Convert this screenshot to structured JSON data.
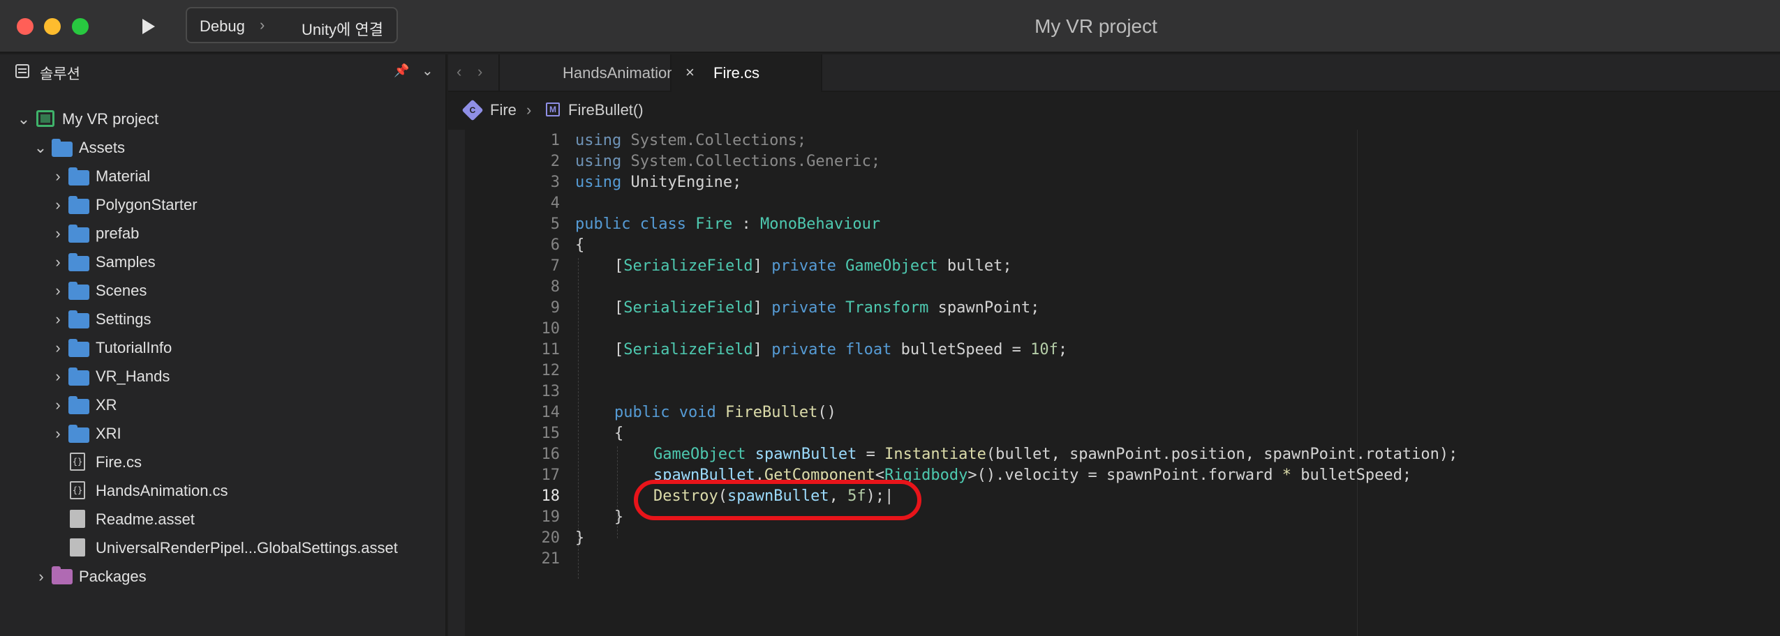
{
  "window": {
    "title": "My VR project",
    "run_config": "Debug",
    "run_target": "Unity에 연결",
    "icons": [
      "play-icon",
      "chevron-right-icon"
    ]
  },
  "sidebar": {
    "title": "솔루션",
    "tree": [
      {
        "label": "My VR project",
        "icon": "project-icon",
        "expanded": true
      },
      {
        "label": "Assets",
        "icon": "folder-icon",
        "expanded": true
      },
      {
        "label": "Material",
        "icon": "folder-icon"
      },
      {
        "label": "PolygonStarter",
        "icon": "folder-icon"
      },
      {
        "label": "prefab",
        "icon": "folder-icon"
      },
      {
        "label": "Samples",
        "icon": "folder-icon"
      },
      {
        "label": "Scenes",
        "icon": "folder-icon"
      },
      {
        "label": "Settings",
        "icon": "folder-icon"
      },
      {
        "label": "TutorialInfo",
        "icon": "folder-icon"
      },
      {
        "label": "VR_Hands",
        "icon": "folder-icon"
      },
      {
        "label": "XR",
        "icon": "folder-icon"
      },
      {
        "label": "XRI",
        "icon": "folder-icon"
      },
      {
        "label": "Fire.cs",
        "icon": "csharp-file-icon"
      },
      {
        "label": "HandsAnimation.cs",
        "icon": "csharp-file-icon"
      },
      {
        "label": "Readme.asset",
        "icon": "asset-file-icon"
      },
      {
        "label": "UniversalRenderPipel...GlobalSettings.asset",
        "icon": "asset-file-icon"
      },
      {
        "label": "Packages",
        "icon": "package-folder-icon"
      }
    ]
  },
  "editor": {
    "tabs": [
      {
        "label": "HandsAnimation.cs",
        "active": false
      },
      {
        "label": "Fire.cs",
        "active": true
      }
    ],
    "breadcrumb": {
      "class": "Fire",
      "method": "FireBullet()"
    },
    "active_line": "18",
    "lines": [
      {
        "n": "1"
      },
      {
        "n": "2"
      },
      {
        "n": "3"
      },
      {
        "n": "4"
      },
      {
        "n": "5"
      },
      {
        "n": "6"
      },
      {
        "n": "7"
      },
      {
        "n": "8"
      },
      {
        "n": "9"
      },
      {
        "n": "10"
      },
      {
        "n": "11"
      },
      {
        "n": "12"
      },
      {
        "n": "13"
      },
      {
        "n": "14"
      },
      {
        "n": "15"
      },
      {
        "n": "16"
      },
      {
        "n": "17"
      },
      {
        "n": "18"
      },
      {
        "n": "19"
      },
      {
        "n": "20"
      },
      {
        "n": "21"
      }
    ],
    "code": {
      "l1": [
        "using",
        " System.Collections;"
      ],
      "l2": [
        "using",
        " System.Collections.Generic;"
      ],
      "l3": [
        "using",
        " UnityEngine;"
      ],
      "l5": [
        "public",
        " ",
        "class",
        " ",
        "Fire",
        " : ",
        "MonoBehaviour"
      ],
      "l6": [
        "{"
      ],
      "l7": [
        "[",
        "SerializeField",
        "] ",
        "private",
        " ",
        "GameObject",
        " bullet;"
      ],
      "l9": [
        "[",
        "SerializeField",
        "] ",
        "private",
        " ",
        "Transform",
        " spawnPoint;"
      ],
      "l11": [
        "[",
        "SerializeField",
        "] ",
        "private",
        " ",
        "float",
        " bulletSpeed = ",
        "10f",
        ";"
      ],
      "l14": [
        "public",
        " ",
        "void",
        " ",
        "FireBullet",
        "()"
      ],
      "l15": [
        "{"
      ],
      "l16": [
        "GameObject",
        " ",
        "spawnBullet",
        " = ",
        "Instantiate",
        "(bullet, spawnPoint.position, spawnPoint.rotation);"
      ],
      "l17": [
        "spawnBullet",
        ".",
        "GetComponent",
        "<",
        "Rigidbody",
        ">().velocity = spawnPoint.forward ",
        "*",
        " bulletSpeed;"
      ],
      "l18": [
        "Destroy",
        "(",
        "spawnBullet",
        ", ",
        "5f",
        ");"
      ],
      "l19": [
        "}"
      ],
      "l20": [
        "}"
      ]
    }
  },
  "annotation": {
    "color": "#e8141a",
    "highlights_line": "18"
  },
  "colors": {
    "keyword": "#569cd6",
    "type": "#4ec9b0",
    "method": "#dcdcaa",
    "identifier": "#9cdcfe",
    "number": "#b5cea8",
    "plain": "#d4d4d4",
    "folder": "#4a8ed6"
  }
}
